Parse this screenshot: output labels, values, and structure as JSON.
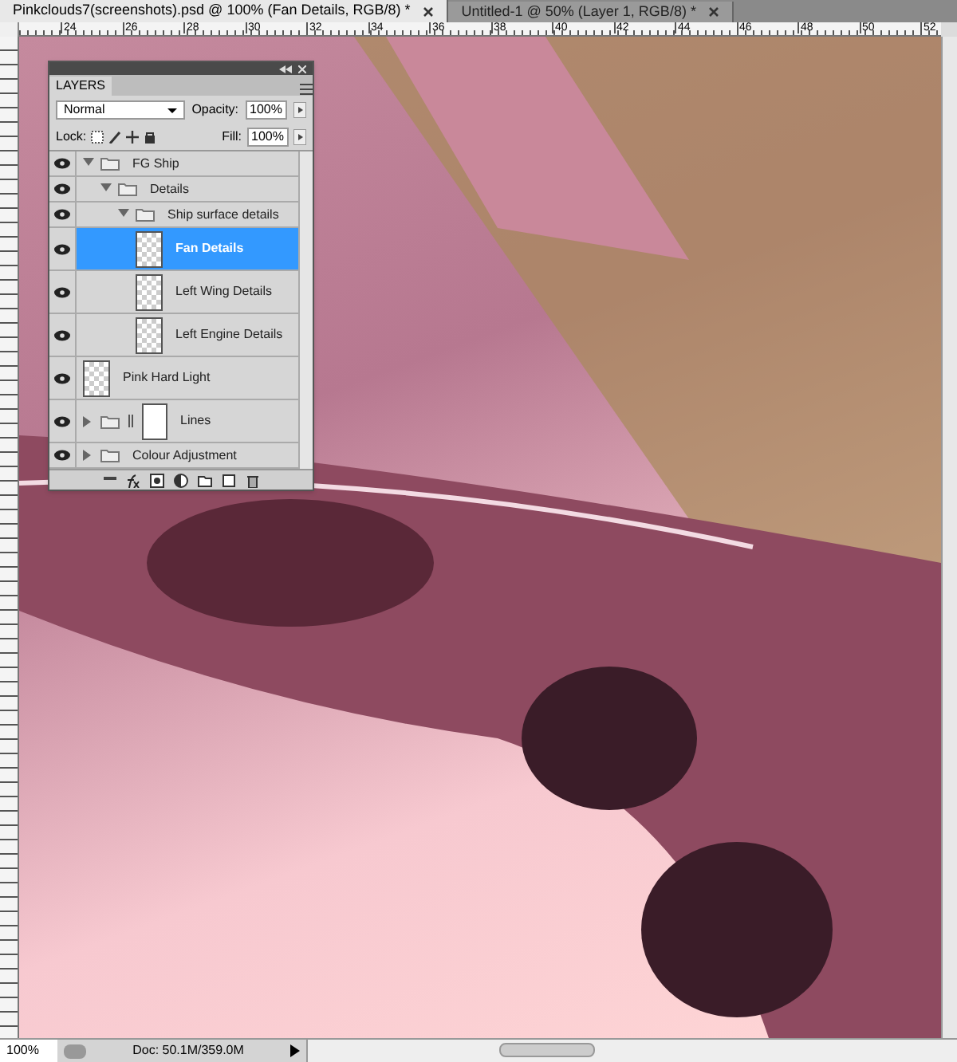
{
  "tabs": [
    {
      "label": "Pinkclouds7(screenshots).psd @ 100% (Fan Details, RGB/8) *",
      "selected": true
    },
    {
      "label": "Untitled-1 @ 50% (Layer 1, RGB/8) *",
      "selected": false
    }
  ],
  "ruler_labels": [
    "24",
    "26",
    "28",
    "30",
    "32",
    "34",
    "36",
    "38",
    "40",
    "42",
    "44",
    "46",
    "48",
    "50",
    "52"
  ],
  "layers_panel": {
    "title": "LAYERS",
    "blend_mode": "Normal",
    "opacity_label": "Opacity:",
    "opacity": "100%",
    "lock_label": "Lock:",
    "fill_label": "Fill:",
    "fill": "100%",
    "layers": [
      {
        "name": "FG Ship",
        "kind": "group",
        "visible": true,
        "selected": false,
        "expanded": true,
        "children": [
          {
            "name": "Details",
            "kind": "group",
            "visible": true,
            "selected": false,
            "expanded": true,
            "children": [
              {
                "name": "Ship surface details",
                "kind": "group",
                "visible": true,
                "selected": false,
                "expanded": true,
                "children": [
                  {
                    "name": "Fan Details",
                    "kind": "layer",
                    "visible": true,
                    "selected": true
                  },
                  {
                    "name": "Left Wing Details",
                    "kind": "layer",
                    "visible": true,
                    "selected": false
                  },
                  {
                    "name": "Left Engine Details",
                    "kind": "layer",
                    "visible": true,
                    "selected": false
                  }
                ]
              }
            ]
          }
        ]
      },
      {
        "name": "Pink Hard Light",
        "kind": "layer",
        "visible": true,
        "selected": false
      },
      {
        "name": "Lines",
        "kind": "masked_group",
        "visible": true,
        "selected": false,
        "expanded": false
      },
      {
        "name": "Colour Adjustment",
        "kind": "group",
        "visible": true,
        "selected": false,
        "expanded": false
      }
    ]
  },
  "status_bar": {
    "zoom": "100%",
    "doc": "Doc: 50.1M/359.0M"
  }
}
